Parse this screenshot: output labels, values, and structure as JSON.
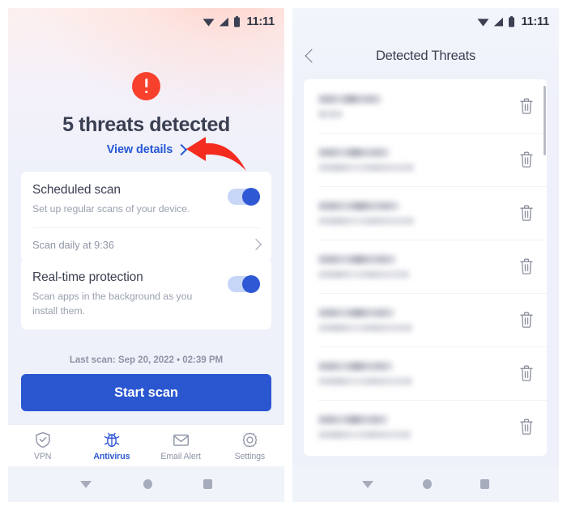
{
  "status_bar": {
    "time": "11:11",
    "icons": [
      "wifi-icon",
      "signal-icon",
      "battery-icon"
    ]
  },
  "left_screen": {
    "hero": {
      "alert_icon": "exclamation-circle-icon",
      "title": "5 threats detected",
      "link_label": "View details",
      "link_chevron": "chevron-right-icon",
      "annotation": "red-arrow-pointing-left"
    },
    "cards": [
      {
        "title": "Scheduled scan",
        "subtitle": "Set up regular scans of your device.",
        "toggle_state": "on",
        "sub_row": {
          "text": "Scan daily at 9:36",
          "chevron": "chevron-right-icon"
        }
      },
      {
        "title": "Real-time protection",
        "subtitle": "Scan apps in the background as you install them.",
        "toggle_state": "on"
      }
    ],
    "last_scan": "Last scan: Sep 20, 2022 • 02:39 PM",
    "primary_button": "Start scan",
    "tabs": [
      {
        "label": "VPN",
        "icon": "shield-check-icon",
        "active": false
      },
      {
        "label": "Antivirus",
        "icon": "bug-icon",
        "active": true
      },
      {
        "label": "Email Alert",
        "icon": "envelope-icon",
        "active": false
      },
      {
        "label": "Settings",
        "icon": "gear-icon",
        "active": false
      }
    ]
  },
  "right_screen": {
    "header": {
      "back_icon": "chevron-left-icon",
      "title": "Detected Threats"
    },
    "threat_rows": [
      {
        "name_blurred": true,
        "name_width": 78,
        "detail_width": 30,
        "delete_icon": "trash-icon"
      },
      {
        "name_blurred": true,
        "name_width": 88,
        "detail_width": 118,
        "delete_icon": "trash-icon"
      },
      {
        "name_blurred": true,
        "name_width": 100,
        "detail_width": 118,
        "delete_icon": "trash-icon"
      },
      {
        "name_blurred": true,
        "name_width": 96,
        "detail_width": 112,
        "delete_icon": "trash-icon"
      },
      {
        "name_blurred": true,
        "name_width": 94,
        "detail_width": 116,
        "delete_icon": "trash-icon"
      },
      {
        "name_blurred": true,
        "name_width": 92,
        "detail_width": 116,
        "delete_icon": "trash-icon"
      },
      {
        "name_blurred": true,
        "name_width": 86,
        "detail_width": 114,
        "delete_icon": "trash-icon"
      }
    ],
    "scrollbar": "vertical-scrollbar"
  },
  "android_nav": {
    "back": "back-triangle-icon",
    "home": "home-circle-icon",
    "recents": "recents-square-icon"
  },
  "colors": {
    "accent_blue": "#2a56d0",
    "link_blue": "#2558d6",
    "alert_red": "#f7412d",
    "arrow_red": "#f42b1f",
    "panel_bg": "#eef1fa",
    "card_bg": "#ffffff",
    "text_dark": "#3b4052",
    "text_muted": "#9aa0b0"
  }
}
